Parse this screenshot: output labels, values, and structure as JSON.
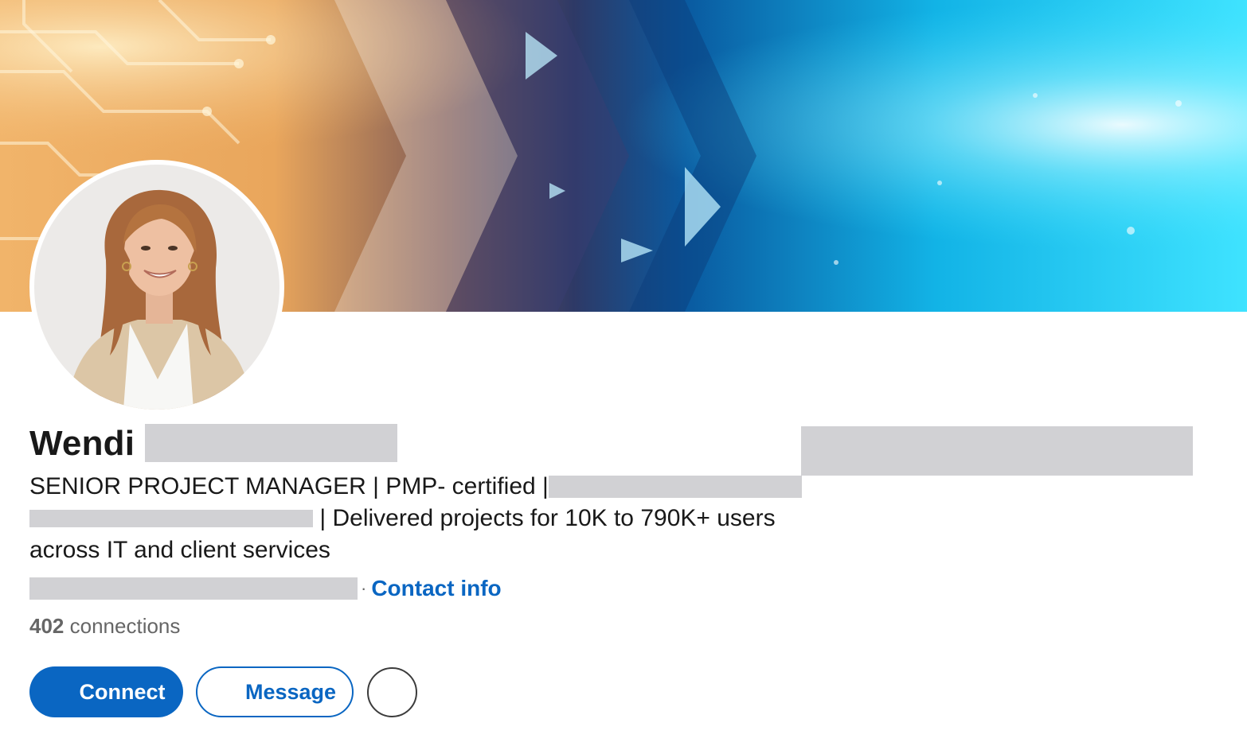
{
  "profile": {
    "first_name": "Wendi",
    "headline_line1": "SENIOR PROJECT MANAGER | PMP- certified |",
    "headline_line2": "| Delivered projects for 10K to 790K+ users",
    "headline_line3": "across IT and client services",
    "contact_label": "Contact info",
    "location_separator": "·",
    "connections_count": "402",
    "connections_label": "connections"
  },
  "actions": {
    "connect_label": "Connect",
    "message_label": "Message"
  },
  "colors": {
    "brand_blue": "#0a66c2",
    "redaction_gray": "#d1d1d4",
    "text_primary": "#191919",
    "text_secondary": "#666666"
  },
  "icons": {
    "more_button": "more-options-icon"
  }
}
